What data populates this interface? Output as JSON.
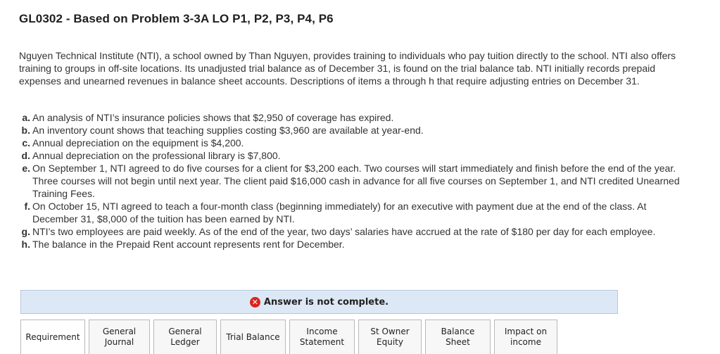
{
  "title": "GL0302 - Based on Problem 3-3A LO P1, P2, P3, P4, P6",
  "intro": "Nguyen Technical Institute (NTI), a school owned by Than Nguyen, provides training to individuals who pay tuition directly to the school. NTI also offers training to groups in off-site locations. Its unadjusted trial balance as of December 31, is found on the trial balance tab. NTI initially records prepaid expenses and unearned revenues in balance sheet accounts. Descriptions of items a through h that require adjusting entries on December 31.",
  "items": [
    {
      "letter": "a.",
      "text": "An analysis of NTI’s insurance policies shows that $2,950 of coverage has expired."
    },
    {
      "letter": "b.",
      "text": "An inventory count shows that teaching supplies costing $3,960 are available at year-end."
    },
    {
      "letter": "c.",
      "text": "Annual depreciation on the equipment is $4,200."
    },
    {
      "letter": "d.",
      "text": "Annual depreciation on the professional library is $7,800."
    },
    {
      "letter": "e.",
      "text": "On September 1, NTI agreed to do five courses for a client for $3,200 each. Two courses will start immediately and finish before the end of the year. Three courses will not begin until next year. The client paid $16,000 cash in advance for all five courses on September 1, and NTI credited Unearned Training Fees."
    },
    {
      "letter": "f.",
      "text": "On October 15, NTI agreed to teach a four-month class (beginning immediately) for an executive with payment due at the end of the class. At December 31, $8,000 of the tuition has been earned by NTI."
    },
    {
      "letter": "g.",
      "text": "NTI’s two employees are paid weekly. As of the end of the year, two days’ salaries have accrued at the rate of $180 per day for each employee."
    },
    {
      "letter": "h.",
      "text": "The balance in the Prepaid Rent account represents rent for December."
    }
  ],
  "banner": {
    "icon": "error-x-icon",
    "icon_glyph": "✕",
    "text": "Answer is not complete.",
    "background": "#dde8f6",
    "icon_color": "#d9241f"
  },
  "tabs": [
    {
      "label": "Requirement"
    },
    {
      "label": "General\nJournal"
    },
    {
      "label": "General\nLedger"
    },
    {
      "label": "Trial Balance"
    },
    {
      "label": "Income\nStatement"
    },
    {
      "label": "St Owner\nEquity"
    },
    {
      "label": "Balance Sheet"
    },
    {
      "label": "Impact on\nincome"
    }
  ]
}
